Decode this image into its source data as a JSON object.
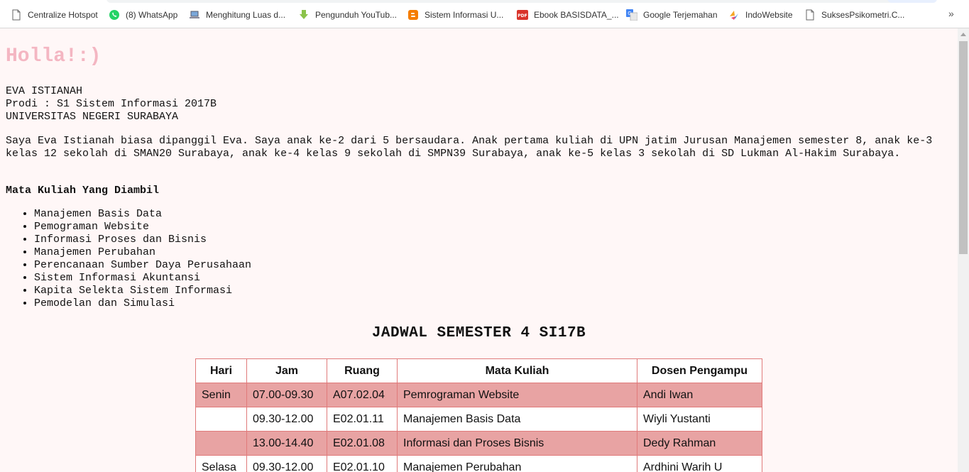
{
  "bookmarks": [
    {
      "label": "Centralize Hotspot",
      "icon": "page-icon"
    },
    {
      "label": "(8) WhatsApp",
      "icon": "whatsapp-icon"
    },
    {
      "label": "Menghitung Luas d...",
      "icon": "laptop-icon"
    },
    {
      "label": "Pengunduh YouTub...",
      "icon": "download-arrow-icon"
    },
    {
      "label": "Sistem Informasi U...",
      "icon": "blogger-icon"
    },
    {
      "label": "Ebook BASISDATA_...",
      "icon": "pdf-icon"
    },
    {
      "label": "Google Terjemahan",
      "icon": "translate-icon"
    },
    {
      "label": "IndoWebsite",
      "icon": "indowebsite-icon"
    },
    {
      "label": "SuksesPsikometri.C...",
      "icon": "page-icon"
    }
  ],
  "bookmarks_more": "»",
  "page": {
    "greeting": "Holla!:)",
    "identity": {
      "name": "EVA ISTIANAH",
      "prodi": "Prodi : S1 Sistem Informasi 2017B",
      "university": "UNIVERSITAS NEGERI SURABAYA"
    },
    "bio": "Saya Eva Istianah biasa dipanggil Eva. Saya anak ke-2 dari 5 bersaudara. Anak pertama kuliah di UPN jatim Jurusan Manajemen semester 8, anak ke-3 kelas 12 sekolah di SMAN20 Surabaya, anak ke-4 kelas 9 sekolah di SMPN39 Surabaya, anak ke-5 kelas 3 sekolah di SD Lukman Al-Hakim Surabaya.",
    "courses_title": "Mata Kuliah Yang Diambil",
    "courses": [
      "Manajemen Basis Data",
      "Pemograman Website",
      "Informasi Proses dan Bisnis",
      "Manajemen Perubahan",
      "Perencanaan Sumber Daya Perusahaan",
      "Sistem Informasi Akuntansi",
      "Kapita Selekta Sistem Informasi",
      "Pemodelan dan Simulasi"
    ],
    "schedule_title": "JADWAL SEMESTER 4 SI17B",
    "table": {
      "headers": [
        "Hari",
        "Jam",
        "Ruang",
        "Mata Kuliah",
        "Dosen Pengampu"
      ],
      "rows": [
        [
          "Senin",
          "07.00-09.30",
          "A07.02.04",
          "Pemrograman Website",
          "Andi Iwan"
        ],
        [
          "",
          "09.30-12.00",
          "E02.01.11",
          "Manajemen Basis Data",
          "Wiyli Yustanti"
        ],
        [
          "",
          "13.00-14.40",
          "E02.01.08",
          "Informasi dan Proses Bisnis",
          "Dedy Rahman"
        ],
        [
          "Selasa",
          "09.30-12.00",
          "E02.01.10",
          "Manajemen Perubahan",
          "Ardhini Warih U"
        ]
      ]
    }
  },
  "colors": {
    "greeting": "#f4b6c2",
    "page_bg": "#fff7f7",
    "row_highlight": "#e8a3a3",
    "table_border": "#e07a7a"
  }
}
